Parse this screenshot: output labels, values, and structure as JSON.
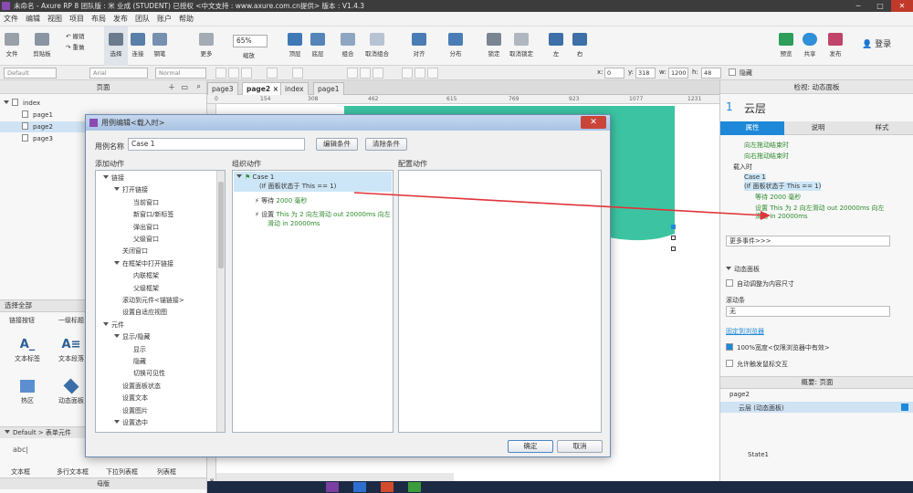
{
  "window": {
    "title": "未命名 - Axure RP 8 团队版 : 米 业成 (STUDENT) 已授权   <中文支持 : www.axure.com.cn提供> 版本 : V1.4.3"
  },
  "menu": [
    "文件",
    "编辑",
    "视图",
    "项目",
    "布局",
    "发布",
    "团队",
    "账户",
    "帮助"
  ],
  "toolbar": {
    "file": "文件",
    "clipboard": "剪贴板",
    "undo": "撤销",
    "redo": "重做",
    "select": "选择",
    "connect": "连接",
    "pen": "钢笔",
    "more": "更多",
    "zoom_value": "65%",
    "zoom": "缩放",
    "top": "顶层",
    "bottom": "底层",
    "group": "组合",
    "ungroup": "取消组合",
    "align": "对齐",
    "distribute": "分布",
    "lock": "锁定",
    "unlock": "取消锁定",
    "left": "左",
    "right": "右",
    "preview": "预览",
    "share": "共享",
    "publish": "发布",
    "login": "登录"
  },
  "format": {
    "style": "Default",
    "font": "Arial",
    "weight": "Normal",
    "x_label": "x:",
    "x": "0",
    "y_label": "y:",
    "y": "318",
    "w_label": "w:",
    "w": "1200",
    "h_label": "h:",
    "h": "48",
    "hidden": "隐藏"
  },
  "pages_panel": {
    "title": "页面",
    "items": [
      {
        "name": "index"
      },
      {
        "name": "page1"
      },
      {
        "name": "page2"
      },
      {
        "name": "page3"
      }
    ]
  },
  "widgets_panel": {
    "select_all": "选择全部",
    "link_items": [
      "链接按钮",
      "一级标题"
    ],
    "items": [
      "文本标签",
      "文本段落",
      "热区",
      "动态面板"
    ],
    "library": "Default > 表单元件",
    "form_items": [
      "文本框",
      "多行文本框",
      "下拉列表框",
      "列表框"
    ],
    "masters": "母版"
  },
  "canvas": {
    "tabs": [
      "page3",
      "page2",
      "index",
      "page1"
    ],
    "ruler": [
      "0",
      "154",
      "308",
      "462",
      "615",
      "769",
      "923",
      "1077",
      "1231"
    ],
    "vruler": "923"
  },
  "dialog": {
    "title": "用例编辑<载入时>",
    "case_name_label": "用例名称",
    "case_name_value": "Case 1",
    "edit_condition": "编辑条件",
    "clear_condition": "清除条件",
    "add_action": "添加动作",
    "organize_action": "组织动作",
    "config_action": "配置动作",
    "actions_tree": [
      {
        "label": "链接",
        "level": 0,
        "group": true
      },
      {
        "label": "打开链接",
        "level": 1,
        "group": true
      },
      {
        "label": "当前窗口",
        "level": 2
      },
      {
        "label": "新窗口/新标签",
        "level": 2
      },
      {
        "label": "弹出窗口",
        "level": 2
      },
      {
        "label": "父级窗口",
        "level": 2
      },
      {
        "label": "关闭窗口",
        "level": 1
      },
      {
        "label": "在框架中打开链接",
        "level": 1,
        "group": true
      },
      {
        "label": "内联框架",
        "level": 2
      },
      {
        "label": "父级框架",
        "level": 2
      },
      {
        "label": "滚动到元件<锚链接>",
        "level": 1
      },
      {
        "label": "设置自适应视图",
        "level": 1
      },
      {
        "label": "元件",
        "level": 0,
        "group": true
      },
      {
        "label": "显示/隐藏",
        "level": 1,
        "group": true
      },
      {
        "label": "显示",
        "level": 2
      },
      {
        "label": "隐藏",
        "level": 2
      },
      {
        "label": "切换可见性",
        "level": 2
      },
      {
        "label": "设置面板状态",
        "level": 1
      },
      {
        "label": "设置文本",
        "level": 1
      },
      {
        "label": "设置图片",
        "level": 1
      },
      {
        "label": "设置选中",
        "level": 1,
        "group": true
      }
    ],
    "case_title": "Case 1",
    "case_condition": "(If 面板状态于 This == 1)",
    "action1_prefix": "等待",
    "action1_value": "2000 毫秒",
    "action2_prefix": "设置",
    "action2_line1": "This 为 2 向左滑动 out 20000ms 向左",
    "action2_line2": "滑动 in 20000ms",
    "ok": "确定",
    "cancel": "取消"
  },
  "inspector": {
    "header": "检视: 动态面板",
    "number": "1",
    "name": "云层",
    "tabs": [
      "属性",
      "说明",
      "样式"
    ],
    "events": [
      {
        "text": "向左拖动结束时",
        "indent": 1,
        "green": true
      },
      {
        "text": "向右拖动结束时",
        "indent": 1,
        "green": true
      },
      {
        "text": "载入时",
        "indent": 0,
        "green": false
      },
      {
        "text": "Case 1",
        "indent": 1,
        "green": false
      },
      {
        "text": "(If 面板状态于 This == 1)",
        "indent": 1,
        "green": false
      },
      {
        "text": "等待 2000 毫秒",
        "indent": 2,
        "green": true
      },
      {
        "text": "设置 This 为 2 向左滑动 out 20000ms 向左",
        "indent": 2,
        "green": true
      },
      {
        "text": "滑动 in 20000ms",
        "indent": 2,
        "green": true
      }
    ],
    "more_events": "更多事件>>>",
    "section": "动态面板",
    "auto_resize": "自动调整为内容尺寸",
    "scrollbar_label": "滚动条",
    "scrollbar_value": "无",
    "pin_browser": "固定到浏览器",
    "full_width": "100%宽度<仅限浏览器中有效>",
    "allow_mouse": "允许触发鼠标交互"
  },
  "outline": {
    "title": "概要: 页面",
    "page": "page2",
    "items": [
      "云层 (动态面板)",
      "State1"
    ]
  },
  "colors": {
    "accent": "#1e88d8",
    "teal": "#3cc4a2",
    "arrow": "#e0343a",
    "action_green": "#2e8b2e"
  }
}
